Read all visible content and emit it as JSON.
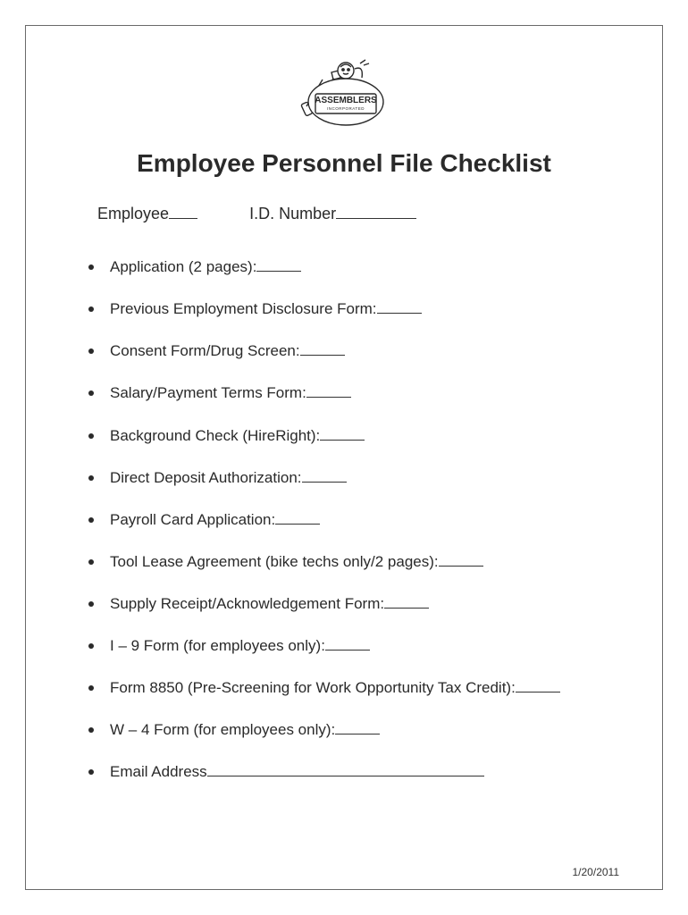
{
  "logo_label": "ASSEMBLERS",
  "logo_sublabel": "INCORPORATED",
  "title": "Employee Personnel File Checklist",
  "header": {
    "employee_label": "Employee",
    "id_label": "I.D. Number"
  },
  "items": [
    {
      "text": "Application (2 pages):",
      "line": "check"
    },
    {
      "text": "Previous Employment Disclosure Form:",
      "line": "check"
    },
    {
      "text": "Consent Form/Drug Screen:",
      "line": "check"
    },
    {
      "text": "Salary/Payment Terms Form:",
      "line": "check"
    },
    {
      "text": "Background Check (HireRight):",
      "line": "check"
    },
    {
      "text": "Direct Deposit Authorization:",
      "line": "check"
    },
    {
      "text": "Payroll Card  Application:",
      "line": "check"
    },
    {
      "text": "Tool Lease Agreement (bike techs only/2 pages):",
      "line": "check"
    },
    {
      "text": "Supply Receipt/Acknowledgement Form:",
      "line": "check"
    },
    {
      "text": "I – 9 Form (for employees only):",
      "line": "check"
    },
    {
      "text": "Form 8850 (Pre-Screening for Work Opportunity Tax Credit):",
      "line": "check"
    },
    {
      "text": "W – 4 Form (for employees only):",
      "line": "check"
    },
    {
      "text": "Email Address",
      "line": "long"
    }
  ],
  "date": "1/20/2011"
}
